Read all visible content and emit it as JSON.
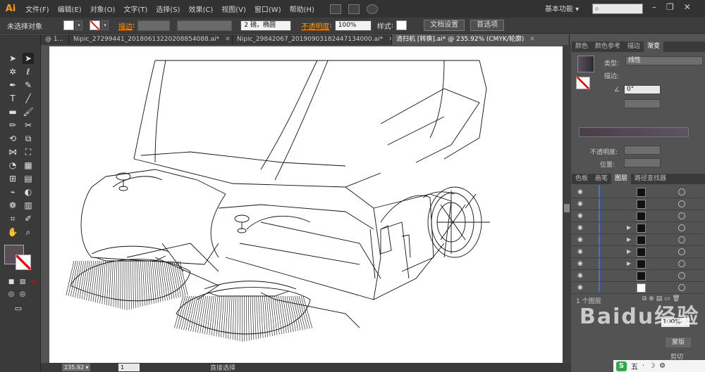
{
  "menubar": {
    "logo": "Ai",
    "items": [
      "文件(F)",
      "编辑(E)",
      "对象(O)",
      "文字(T)",
      "选择(S)",
      "效果(C)",
      "视图(V)",
      "窗口(W)",
      "帮助(H)"
    ],
    "workspace": "基本功能",
    "search_placeholder": ""
  },
  "controlbar": {
    "selection_status": "未选择对象",
    "stroke_label": "描边",
    "brush_value": "2 磅。椭圆",
    "opacity_label": "不透明度",
    "opacity_value": "100%",
    "style_label": "样式",
    "doc_setup_button": "文档设置",
    "preferences_button": "首选项"
  },
  "tabs": [
    {
      "label": "@ 1...",
      "active": false
    },
    {
      "label": "Nipic_27299441_20180613220208854088.ai*",
      "active": false
    },
    {
      "label": "Nipic_29842067_20190903182447134000.ai*",
      "active": false
    },
    {
      "label": "清扫机 [转换].ai* @ 235.92% (CMYK/轮廓)",
      "active": true
    }
  ],
  "statusbar": {
    "zoom": "235.92",
    "page": "1",
    "tool_name": "直接选择"
  },
  "panels": {
    "gradient_tabs": [
      "颜色",
      "颜色参考",
      "描边",
      "渐变"
    ],
    "gradient_active": "渐变",
    "type_label": "类型",
    "type_value": "线性",
    "stroke_label": "描边",
    "angle_value": "0°",
    "opacity_label": "不透明度",
    "position_label": "位置",
    "layer_tabs": [
      "色板",
      "画笔",
      "图层",
      "路径查找器"
    ],
    "layer_active": "图层",
    "layer_count": "1 个图层",
    "transparency_pct": "100%",
    "mask_button": "蒙版",
    "clip_label": "剪切"
  },
  "ime": {
    "logo": "S",
    "items": [
      "五",
      "·",
      "☽",
      "⚙"
    ]
  },
  "watermark": "Baidu经验",
  "colors": {
    "accent": "#ff9a00",
    "fill": "#5a4d55",
    "layer_line": "#4a6fd8"
  }
}
